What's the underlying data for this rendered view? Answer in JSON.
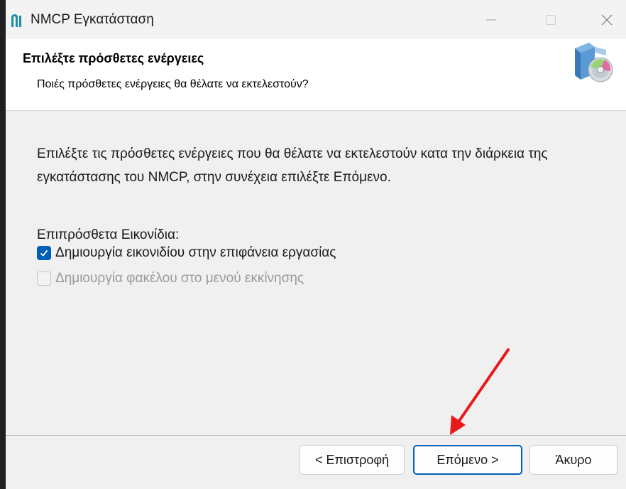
{
  "window": {
    "title": "NMCP Εγκατάσταση",
    "controls": [
      "minimize-icon",
      "maximize-icon",
      "close-icon"
    ]
  },
  "header": {
    "title": "Επιλέξτε πρόσθετες ενέργειες",
    "subtitle": "Ποιές πρόσθετες ενέργειες θα θέλατε να εκτελεστούν?",
    "icon": "installer-box-icon"
  },
  "body": {
    "description": "Επιλέξτε τις πρόσθετες ενέργειες που θα θέλατε να εκτελεστούν κατα την διάρκεια της εγκατάστασης του NMCP, στην συνέχεια επιλέξτε Επόμενο.",
    "group_label": "Επιπρόσθετα Εικονίδια:",
    "options": [
      {
        "label": "Δημιουργία εικονιδίου στην επιφάνεια εργασίας",
        "checked": true,
        "enabled": true
      },
      {
        "label": "Δημιουργία φακέλου στο μενού εκκίνησης",
        "checked": false,
        "enabled": false
      }
    ]
  },
  "buttons": {
    "back": "< Επιστροφή",
    "next": "Επόμενο >",
    "cancel": "Άκυρο"
  },
  "colors": {
    "accent": "#005fb8",
    "annotation_arrow": "#e8191b"
  }
}
